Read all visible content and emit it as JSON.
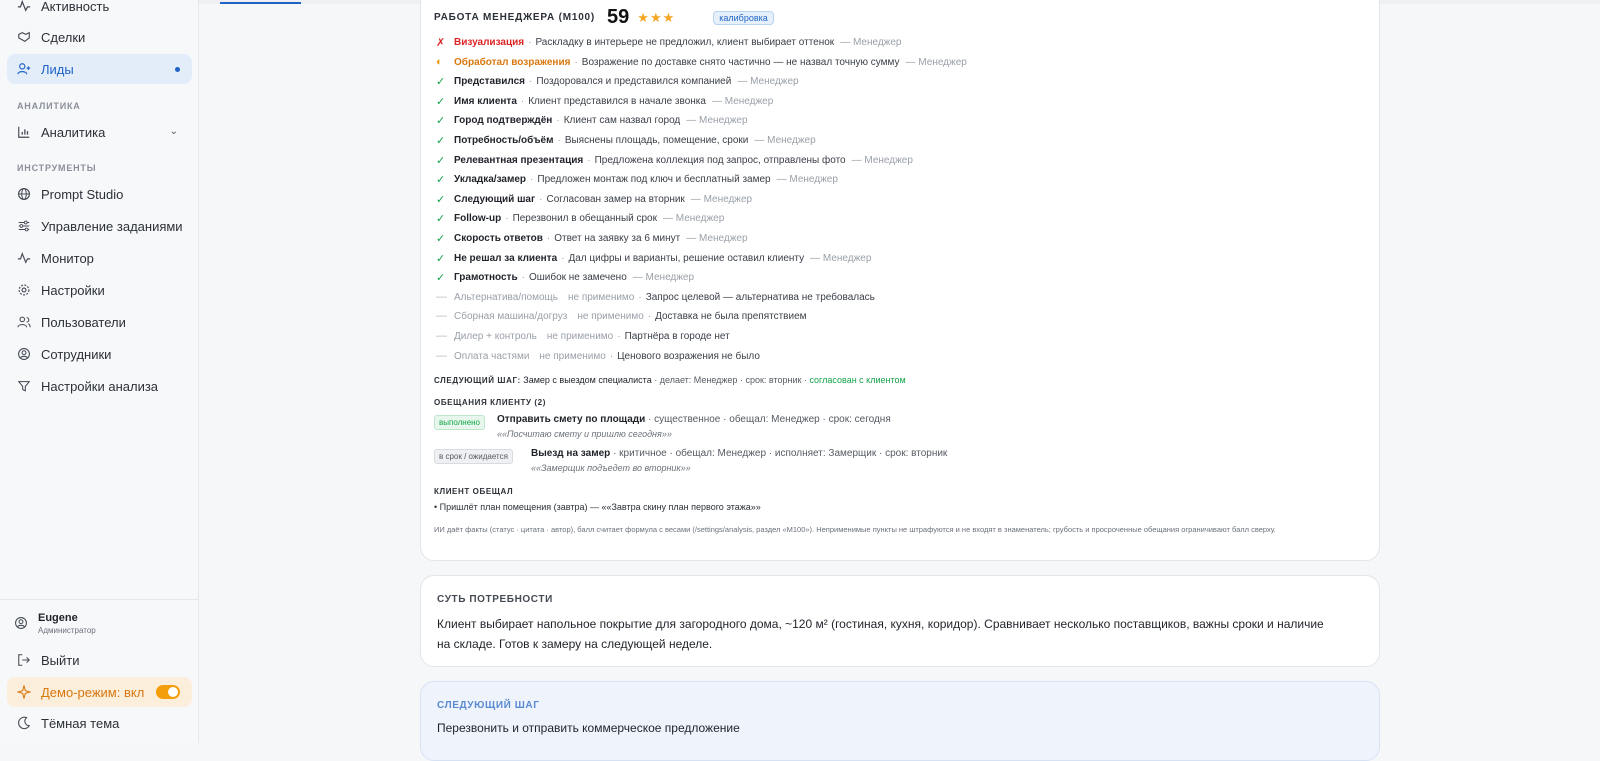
{
  "sidebar": {
    "items_top": [
      {
        "label": "Активность",
        "icon": "activity-icon"
      },
      {
        "label": "Сделки",
        "icon": "handshake-icon"
      },
      {
        "label": "Лиды",
        "icon": "user-plus-icon",
        "active": true
      }
    ],
    "section_analytics": "АНАЛИТИКА",
    "analytics_item": {
      "label": "Аналитика",
      "icon": "bar-chart-icon"
    },
    "section_tools": "ИНСТРУМЕНТЫ",
    "tools": [
      {
        "label": "Prompt Studio",
        "icon": "globe-icon"
      },
      {
        "label": "Управление заданиями",
        "icon": "sliders-icon"
      },
      {
        "label": "Монитор",
        "icon": "pulse-icon"
      },
      {
        "label": "Настройки",
        "icon": "gear-icon"
      },
      {
        "label": "Пользователи",
        "icon": "users-icon"
      },
      {
        "label": "Сотрудники",
        "icon": "user-circle-icon"
      },
      {
        "label": "Настройки анализа",
        "icon": "filter-icon"
      }
    ],
    "user": {
      "name": "Eugene",
      "role": "Администратор"
    },
    "logout": "Выйти",
    "demo": "Демо-режим: вкл",
    "theme": "Тёмная тема"
  },
  "score_card": {
    "title": "РАБОТА МЕНЕДЖЕРА (M100)",
    "score": "59",
    "stars": "★★★",
    "badge": "калибровка",
    "criteria": [
      {
        "status": "fail",
        "mark": "✗",
        "name": "Визуализация",
        "desc": "Раскладку в интерьере не предложил, клиент выбирает оттенок",
        "who": "— Менеджер"
      },
      {
        "status": "partial",
        "mark": "◐",
        "name": "Обработал возражения",
        "desc": "Возражение по доставке снято частично — не назвал точную сумму",
        "who": "— Менеджер"
      },
      {
        "status": "ok",
        "mark": "✓",
        "name": "Представился",
        "desc": "Поздоровался и представился компанией",
        "who": "— Менеджер"
      },
      {
        "status": "ok",
        "mark": "✓",
        "name": "Имя клиента",
        "desc": "Клиент представился в начале звонка",
        "who": "— Менеджер"
      },
      {
        "status": "ok",
        "mark": "✓",
        "name": "Город подтверждён",
        "desc": "Клиент сам назвал город",
        "who": "— Менеджер"
      },
      {
        "status": "ok",
        "mark": "✓",
        "name": "Потребность/объём",
        "desc": "Выяснены площадь, помещение, сроки",
        "who": "— Менеджер"
      },
      {
        "status": "ok",
        "mark": "✓",
        "name": "Релевантная презентация",
        "desc": "Предложена коллекция под запрос, отправлены фото",
        "who": "— Менеджер"
      },
      {
        "status": "ok",
        "mark": "✓",
        "name": "Укладка/замер",
        "desc": "Предложен монтаж под ключ и бесплатный замер",
        "who": "— Менеджер"
      },
      {
        "status": "ok",
        "mark": "✓",
        "name": "Следующий шаг",
        "desc": "Согласован замер на вторник",
        "who": "— Менеджер"
      },
      {
        "status": "ok",
        "mark": "✓",
        "name": "Follow-up",
        "desc": "Перезвонил в обещанный срок",
        "who": "— Менеджер"
      },
      {
        "status": "ok",
        "mark": "✓",
        "name": "Скорость ответов",
        "desc": "Ответ на заявку за 6 минут",
        "who": "— Менеджер"
      },
      {
        "status": "ok",
        "mark": "✓",
        "name": "Не решал за клиента",
        "desc": "Дал цифры и варианты, решение оставил клиенту",
        "who": "— Менеджер"
      },
      {
        "status": "ok",
        "mark": "✓",
        "name": "Грамотность",
        "desc": "Ошибок не замечено",
        "who": "— Менеджер"
      },
      {
        "status": "na",
        "mark": "—",
        "name": "Альтернатива/помощь",
        "na_label": "не применимо",
        "desc": "Запрос целевой — альтернатива не требовалась"
      },
      {
        "status": "na",
        "mark": "—",
        "name": "Сборная машина/догруз",
        "na_label": "не применимо",
        "desc": "Доставка не была препятствием"
      },
      {
        "status": "na",
        "mark": "—",
        "name": "Дилер + контроль",
        "na_label": "не применимо",
        "desc": "Партнёра в городе нет"
      },
      {
        "status": "na",
        "mark": "—",
        "name": "Оплата частями",
        "na_label": "не применимо",
        "desc": "Ценового возражения не было"
      }
    ],
    "next_step": {
      "label": "СЛЕДУЮЩИЙ ШАГ:",
      "value": "Замер с выездом специалиста",
      "meta": "· делает: Менеджер · срок: вторник ·",
      "status": "согласован с клиентом"
    },
    "promises": {
      "label": "ОБЕЩАНИЯ КЛИЕНТУ (2)",
      "items": [
        {
          "badge": "выполнено",
          "title": "Отправить смету по площади",
          "meta": "· существенное · обещал: Менеджер · срок: сегодня",
          "quote": "««Посчитаю смету и пришлю сегодня»»"
        },
        {
          "badge": "в срок / ожидается",
          "title": "Выезд на замер",
          "meta": "· критичное · обещал: Менеджер · исполняет: Замерщик · срок: вторник",
          "quote": "««Замерщик подъедет во вторник»»"
        }
      ]
    },
    "client_promised": {
      "label": "КЛИЕНТ ОБЕЩАЛ",
      "item": "• Пришлёт план помещения (завтра) — ««Завтра скину план первого этажа»»"
    },
    "footnote": "ИИ даёт факты (статус · цитата · автор), балл считает формула с весами (/settings/analysis, раздел «M100»). Неприменимые пункты не штрафуются и не входят в знаменатель; грубость и просроченные обещания ограничивают балл сверху."
  },
  "needs_card": {
    "label": "СУТЬ ПОТРЕБНОСТИ",
    "text": "Клиент выбирает напольное покрытие для загородного дома, ~120 м² (гостиная, кухня, коридор). Сравнивает несколько поставщиков, важны сроки и наличие на складе. Готов к замеру на следующей неделе."
  },
  "next_card": {
    "label": "СЛЕДУЮЩИЙ ШАГ",
    "text": "Перезвонить и отправить коммерческое предложение"
  }
}
